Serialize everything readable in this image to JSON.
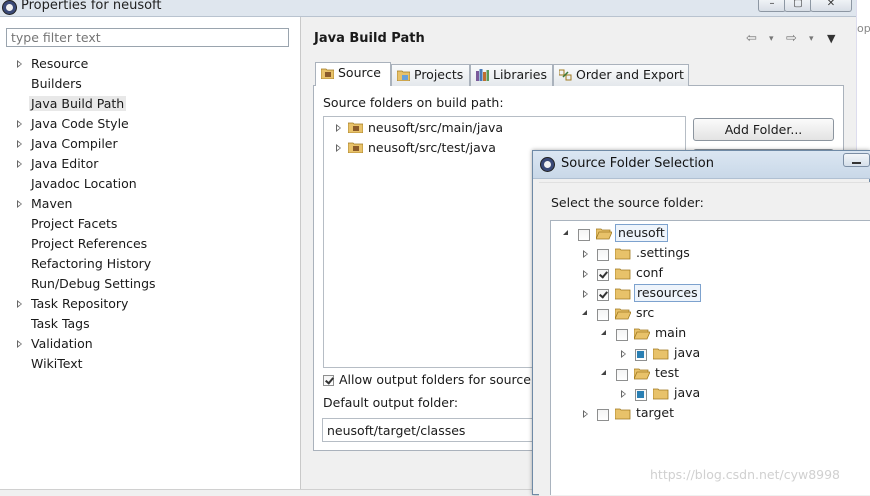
{
  "window": {
    "title": "Properties for neusoft",
    "right_strip_text": "op"
  },
  "filter": {
    "placeholder": "type filter text"
  },
  "nav": {
    "items": [
      {
        "label": "Resource",
        "expandable": true,
        "selected": false
      },
      {
        "label": "Builders",
        "expandable": false,
        "selected": false
      },
      {
        "label": "Java Build Path",
        "expandable": false,
        "selected": true
      },
      {
        "label": "Java Code Style",
        "expandable": true,
        "selected": false
      },
      {
        "label": "Java Compiler",
        "expandable": true,
        "selected": false
      },
      {
        "label": "Java Editor",
        "expandable": true,
        "selected": false
      },
      {
        "label": "Javadoc Location",
        "expandable": false,
        "selected": false
      },
      {
        "label": "Maven",
        "expandable": true,
        "selected": false
      },
      {
        "label": "Project Facets",
        "expandable": false,
        "selected": false
      },
      {
        "label": "Project References",
        "expandable": false,
        "selected": false
      },
      {
        "label": "Refactoring History",
        "expandable": false,
        "selected": false
      },
      {
        "label": "Run/Debug Settings",
        "expandable": false,
        "selected": false
      },
      {
        "label": "Task Repository",
        "expandable": true,
        "selected": false
      },
      {
        "label": "Task Tags",
        "expandable": false,
        "selected": false
      },
      {
        "label": "Validation",
        "expandable": true,
        "selected": false
      },
      {
        "label": "WikiText",
        "expandable": false,
        "selected": false
      }
    ]
  },
  "page": {
    "title": "Java Build Path",
    "tabs": [
      {
        "label": "Source",
        "icon": "source-folder-icon",
        "active": true
      },
      {
        "label": "Projects",
        "icon": "projects-icon",
        "active": false
      },
      {
        "label": "Libraries",
        "icon": "libraries-icon",
        "active": false
      },
      {
        "label": "Order and Export",
        "icon": "order-export-icon",
        "active": false
      }
    ],
    "source_label": "Source folders on build path:",
    "source_folders": [
      "neusoft/src/main/java",
      "neusoft/src/test/java"
    ],
    "add_folder_button": "Add Folder...",
    "allow_output_label": "Allow output folders for source fo",
    "allow_output_checked": true,
    "default_output_label": "Default output folder:",
    "default_output_value": "neusoft/target/classes"
  },
  "dialog": {
    "title": "Source Folder Selection",
    "label": "Select the source folder:",
    "tree": [
      {
        "label": "neusoft",
        "level": 0,
        "expanded": true,
        "check": "off",
        "highlight": true,
        "type": "project"
      },
      {
        "label": ".settings",
        "level": 1,
        "expanded": false,
        "check": "off",
        "highlight": false,
        "type": "folder"
      },
      {
        "label": "conf",
        "level": 1,
        "expanded": false,
        "check": "on",
        "highlight": false,
        "type": "folder"
      },
      {
        "label": "resources",
        "level": 1,
        "expanded": false,
        "check": "on",
        "highlight": true,
        "type": "folder"
      },
      {
        "label": "src",
        "level": 1,
        "expanded": true,
        "check": "off",
        "highlight": false,
        "type": "folder"
      },
      {
        "label": "main",
        "level": 2,
        "expanded": true,
        "check": "off",
        "highlight": false,
        "type": "folder"
      },
      {
        "label": "java",
        "level": 3,
        "expanded": false,
        "check": "partial",
        "highlight": false,
        "type": "folder"
      },
      {
        "label": "test",
        "level": 2,
        "expanded": true,
        "check": "off",
        "highlight": false,
        "type": "folder"
      },
      {
        "label": "java",
        "level": 3,
        "expanded": false,
        "check": "partial",
        "highlight": false,
        "type": "folder"
      },
      {
        "label": "target",
        "level": 1,
        "expanded": false,
        "check": "off",
        "highlight": false,
        "type": "folder"
      }
    ]
  },
  "watermark": "https://blog.csdn.net/cyw8998",
  "colors": {
    "selection_bg": "#e8e8e8",
    "highlight_border": "#7da2ce",
    "folder_yellow": "#e8c26a",
    "check_blue": "#2a7fb3"
  }
}
